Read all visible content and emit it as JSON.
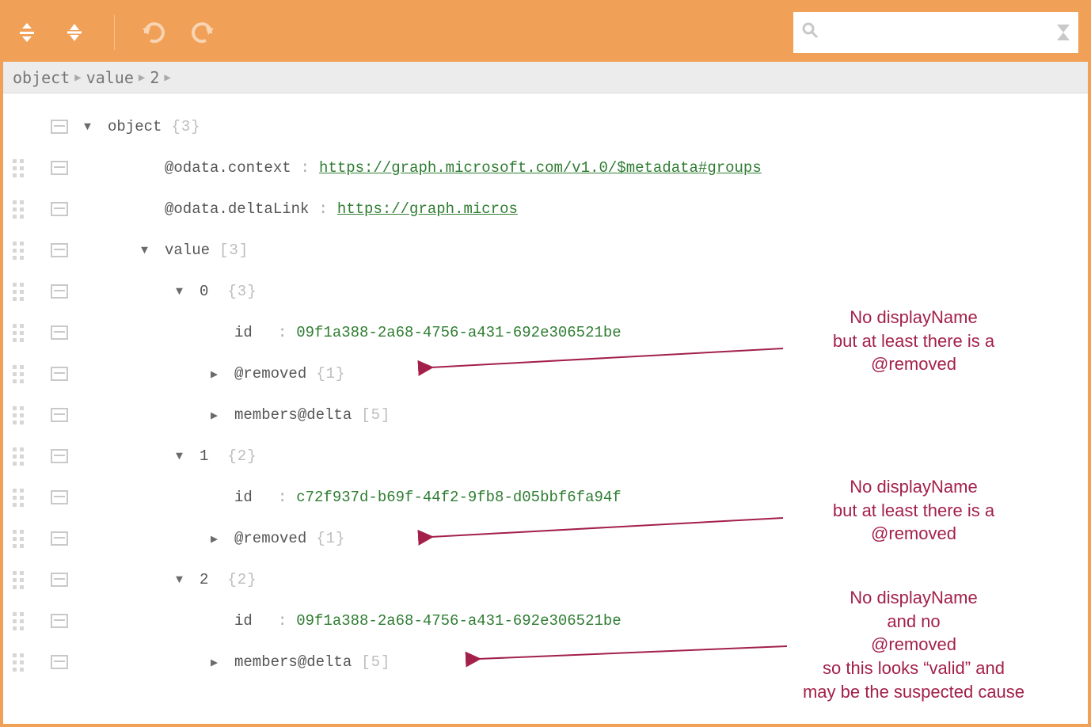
{
  "toolbar": {
    "search_placeholder": ""
  },
  "breadcrumb": {
    "parts": [
      "object",
      "value",
      "2"
    ]
  },
  "tree": {
    "root_label": "object",
    "root_count": "{3}",
    "context_key": "@odata.context",
    "context_val": "https://graph.microsoft.com/v1.0/$metadata#groups",
    "delta_key": "@odata.deltaLink",
    "delta_val": "https://graph.micros",
    "value_label": "value",
    "value_count": "[3]",
    "items": [
      {
        "index": "0",
        "index_count": "{3}",
        "id_key": "id",
        "id_val": "09f1a388-2a68-4756-a431-692e306521be",
        "removed_key": "@removed",
        "removed_count": "{1}",
        "members_key": "members@delta",
        "members_count": "[5]"
      },
      {
        "index": "1",
        "index_count": "{2}",
        "id_key": "id",
        "id_val": "c72f937d-b69f-44f2-9fb8-d05bbf6fa94f",
        "removed_key": "@removed",
        "removed_count": "{1}"
      },
      {
        "index": "2",
        "index_count": "{2}",
        "id_key": "id",
        "id_val": "09f1a388-2a68-4756-a431-692e306521be",
        "members_key": "members@delta",
        "members_count": "[5]"
      }
    ]
  },
  "annotations": {
    "a0": "No displayName\nbut at least there is a\n@removed",
    "a1": "No displayName\nbut at least there is a\n@removed",
    "a2": "No displayName\nand no\n@removed\nso this looks “valid” and\nmay be the suspected cause"
  }
}
